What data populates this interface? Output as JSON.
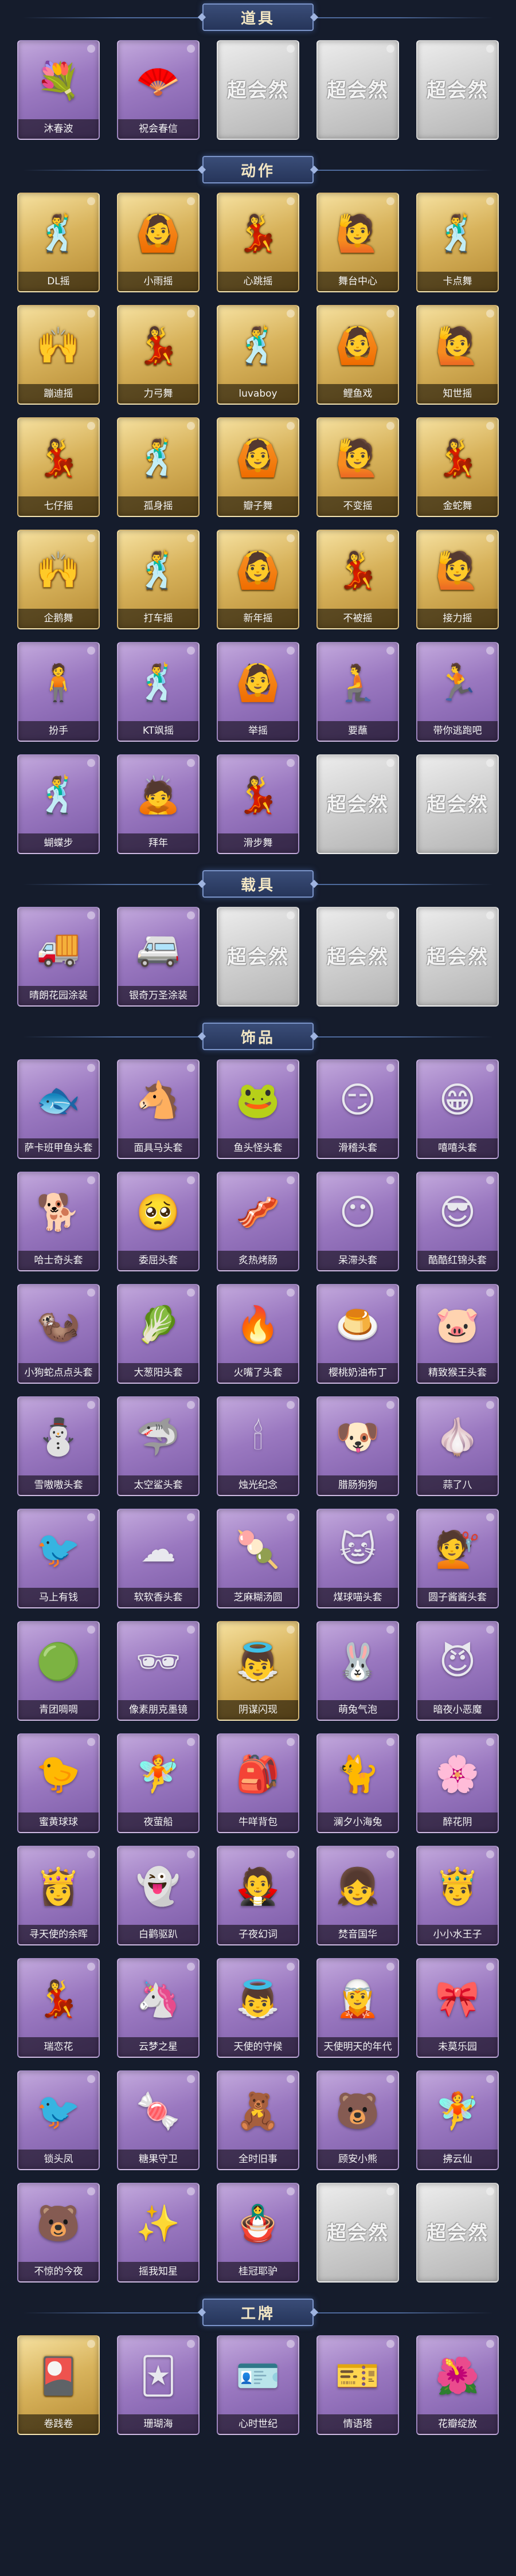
{
  "sections": [
    {
      "title": "道具",
      "rows": 1,
      "items": [
        {
          "label": "沐春波",
          "rarity": "purple",
          "icon": "flower-wreath-icon",
          "glyph": "💐"
        },
        {
          "label": "祝会春信",
          "rarity": "purple",
          "icon": "fan-icon",
          "glyph": "🪭"
        },
        {
          "label": "",
          "rarity": "gray",
          "icon": "placeholder-logo-icon",
          "placeholder": "超会然"
        },
        {
          "label": "",
          "rarity": "gray",
          "icon": "placeholder-logo-icon",
          "placeholder": "超会然"
        },
        {
          "label": "",
          "rarity": "gray",
          "icon": "placeholder-logo-icon",
          "placeholder": "超会然"
        }
      ]
    },
    {
      "title": "动作",
      "rows": 6,
      "items": [
        {
          "label": "DL摇",
          "rarity": "gold",
          "icon": "dance-pose-icon",
          "glyph": "🕺"
        },
        {
          "label": "小雨摇",
          "rarity": "gold",
          "icon": "dance-pose-icon",
          "glyph": "🙆"
        },
        {
          "label": "心跳摇",
          "rarity": "gold",
          "icon": "dance-pose-icon",
          "glyph": "💃"
        },
        {
          "label": "舞台中心",
          "rarity": "gold",
          "icon": "dance-pose-icon",
          "glyph": "🙋"
        },
        {
          "label": "卡点舞",
          "rarity": "gold",
          "icon": "dance-pose-icon",
          "glyph": "🕺"
        },
        {
          "label": "蹦迪摇",
          "rarity": "gold",
          "icon": "dance-pose-icon",
          "glyph": "🙌"
        },
        {
          "label": "力弓舞",
          "rarity": "gold",
          "icon": "dance-pose-icon",
          "glyph": "💃"
        },
        {
          "label": "luvaboy",
          "rarity": "gold",
          "icon": "dance-pose-icon",
          "glyph": "🕺"
        },
        {
          "label": "鲤鱼戏",
          "rarity": "gold",
          "icon": "dance-pose-icon",
          "glyph": "🙆"
        },
        {
          "label": "知世摇",
          "rarity": "gold",
          "icon": "dance-pose-icon",
          "glyph": "🙋"
        },
        {
          "label": "七仔摇",
          "rarity": "gold",
          "icon": "dance-pose-icon",
          "glyph": "💃"
        },
        {
          "label": "孤身摇",
          "rarity": "gold",
          "icon": "dance-pose-icon",
          "glyph": "🕺"
        },
        {
          "label": "瓣子舞",
          "rarity": "gold",
          "icon": "dance-pose-icon",
          "glyph": "🙆"
        },
        {
          "label": "不变摇",
          "rarity": "gold",
          "icon": "dance-pose-icon",
          "glyph": "🙋"
        },
        {
          "label": "金蛇舞",
          "rarity": "gold",
          "icon": "dance-pose-icon",
          "glyph": "💃"
        },
        {
          "label": "企鹅舞",
          "rarity": "gold",
          "icon": "dance-pose-icon",
          "glyph": "🙌"
        },
        {
          "label": "打车摇",
          "rarity": "gold",
          "icon": "dance-pose-icon",
          "glyph": "🕺"
        },
        {
          "label": "新年摇",
          "rarity": "gold",
          "icon": "dance-pose-icon",
          "glyph": "🙆"
        },
        {
          "label": "不被摇",
          "rarity": "gold",
          "icon": "dance-pose-icon",
          "glyph": "💃"
        },
        {
          "label": "接力摇",
          "rarity": "gold",
          "icon": "dance-pose-icon",
          "glyph": "🙋"
        },
        {
          "label": "扮手",
          "rarity": "purple",
          "icon": "dance-pose-icon",
          "glyph": "🧍"
        },
        {
          "label": "KT飒摇",
          "rarity": "purple",
          "icon": "dance-pose-icon",
          "glyph": "🕺"
        },
        {
          "label": "举摇",
          "rarity": "purple",
          "icon": "dance-pose-icon",
          "glyph": "🙆"
        },
        {
          "label": "要蘸",
          "rarity": "purple",
          "icon": "dance-pose-icon",
          "glyph": "🧎"
        },
        {
          "label": "带你逃跑吧",
          "rarity": "purple",
          "icon": "dance-pose-icon",
          "glyph": "🏃"
        },
        {
          "label": "蝴蝶步",
          "rarity": "purple",
          "icon": "dance-pose-icon",
          "glyph": "🕺"
        },
        {
          "label": "拜年",
          "rarity": "purple",
          "icon": "dance-pose-icon",
          "glyph": "🙇"
        },
        {
          "label": "滑步舞",
          "rarity": "purple",
          "icon": "dance-pose-icon",
          "glyph": "💃"
        },
        {
          "label": "",
          "rarity": "gray",
          "icon": "placeholder-logo-icon",
          "placeholder": "超会然"
        },
        {
          "label": "",
          "rarity": "gray",
          "icon": "placeholder-logo-icon",
          "placeholder": "超会然"
        }
      ]
    },
    {
      "title": "载具",
      "rows": 1,
      "items": [
        {
          "label": "晴朗花园涂装",
          "rarity": "purple",
          "icon": "ice-cream-truck-icon",
          "glyph": "🚚"
        },
        {
          "label": "银奇万圣涂装",
          "rarity": "purple",
          "icon": "food-truck-icon",
          "glyph": "🚐"
        },
        {
          "label": "",
          "rarity": "gray",
          "icon": "placeholder-logo-icon",
          "placeholder": "超会然"
        },
        {
          "label": "",
          "rarity": "gray",
          "icon": "placeholder-logo-icon",
          "placeholder": "超会然"
        },
        {
          "label": "",
          "rarity": "gray",
          "icon": "placeholder-logo-icon",
          "placeholder": "超会然"
        }
      ]
    },
    {
      "title": "饰品",
      "rows": 11,
      "items": [
        {
          "label": "萨卡班甲鱼头套",
          "rarity": "purple",
          "icon": "fish-head-icon",
          "glyph": "🐟"
        },
        {
          "label": "面具马头套",
          "rarity": "purple",
          "icon": "horse-head-icon",
          "glyph": "🐴"
        },
        {
          "label": "鱼头怪头套",
          "rarity": "purple",
          "icon": "fish-monster-icon",
          "glyph": "🐸"
        },
        {
          "label": "滑稽头套",
          "rarity": "purple",
          "icon": "smiley-icon",
          "glyph": "😏"
        },
        {
          "label": "嘻嘻头套",
          "rarity": "purple",
          "icon": "grin-icon",
          "glyph": "😁"
        },
        {
          "label": "哈士奇头套",
          "rarity": "purple",
          "icon": "husky-icon",
          "glyph": "🐕"
        },
        {
          "label": "委屈头套",
          "rarity": "purple",
          "icon": "sad-face-icon",
          "glyph": "🥺"
        },
        {
          "label": "炙热烤肠",
          "rarity": "purple",
          "icon": "sausage-icon",
          "glyph": "🥓"
        },
        {
          "label": "呆滞头套",
          "rarity": "purple",
          "icon": "blank-face-icon",
          "glyph": "😶"
        },
        {
          "label": "酷酷红锦头套",
          "rarity": "purple",
          "icon": "cool-pikachu-icon",
          "glyph": "😎"
        },
        {
          "label": "小狗蛇点点头套",
          "rarity": "purple",
          "icon": "blob-icon",
          "glyph": "🦦"
        },
        {
          "label": "大葱阳头套",
          "rarity": "purple",
          "icon": "scallion-icon",
          "glyph": "🥬"
        },
        {
          "label": "火嘴了头套",
          "rarity": "purple",
          "icon": "fire-icon",
          "glyph": "🔥"
        },
        {
          "label": "樱桃奶油布丁",
          "rarity": "purple",
          "icon": "pudding-icon",
          "glyph": "🍮"
        },
        {
          "label": "精致猴王头套",
          "rarity": "purple",
          "icon": "pink-pig-icon",
          "glyph": "🐷"
        },
        {
          "label": "雪嗷嗷头套",
          "rarity": "purple",
          "icon": "snowman-icon",
          "glyph": "⛄"
        },
        {
          "label": "太空鲨头套",
          "rarity": "purple",
          "icon": "shark-icon",
          "glyph": "🦈"
        },
        {
          "label": "烛光纪念",
          "rarity": "purple",
          "icon": "candle-icon",
          "glyph": "🕯"
        },
        {
          "label": "腊肠狗狗",
          "rarity": "purple",
          "icon": "dog-icon",
          "glyph": "🐶"
        },
        {
          "label": "蒜了八",
          "rarity": "purple",
          "icon": "garlic-icon",
          "glyph": "🧄"
        },
        {
          "label": "马上有钱",
          "rarity": "purple",
          "icon": "money-bird-icon",
          "glyph": "🐦"
        },
        {
          "label": "软软香头套",
          "rarity": "purple",
          "icon": "cloud-icon",
          "glyph": "☁"
        },
        {
          "label": "芝麻糊汤圆",
          "rarity": "purple",
          "icon": "dumpling-icon",
          "glyph": "🍡"
        },
        {
          "label": "煤球喵头套",
          "rarity": "purple",
          "icon": "black-cat-icon",
          "glyph": "🐱"
        },
        {
          "label": "圆子酱酱头套",
          "rarity": "purple",
          "icon": "hair-bun-icon",
          "glyph": "💇"
        },
        {
          "label": "青团啁啁",
          "rarity": "purple",
          "icon": "green-blob-icon",
          "glyph": "🟢"
        },
        {
          "label": "像素朋克墨镜",
          "rarity": "purple",
          "icon": "pixel-sunglasses-icon",
          "glyph": "🕶"
        },
        {
          "label": "阴谋闪现",
          "rarity": "gold",
          "icon": "angel-icon",
          "glyph": "👼"
        },
        {
          "label": "萌兔气泡",
          "rarity": "purple",
          "icon": "bunny-icon",
          "glyph": "🐰"
        },
        {
          "label": "暗夜小恶魔",
          "rarity": "purple",
          "icon": "devil-icon",
          "glyph": "😈"
        },
        {
          "label": "蜜黄球球",
          "rarity": "purple",
          "icon": "chick-icon",
          "glyph": "🐤"
        },
        {
          "label": "夜萤船",
          "rarity": "purple",
          "icon": "fairy-icon",
          "glyph": "🧚"
        },
        {
          "label": "牛咩背包",
          "rarity": "purple",
          "icon": "backpack-icon",
          "glyph": "🎒"
        },
        {
          "label": "澜夕小海兔",
          "rarity": "purple",
          "icon": "blue-cat-icon",
          "glyph": "🐈"
        },
        {
          "label": "醉花阴",
          "rarity": "purple",
          "icon": "flower-girl-icon",
          "glyph": "🌸"
        },
        {
          "label": "寻天使的余晖",
          "rarity": "purple",
          "icon": "angel-girl-icon",
          "glyph": "👸"
        },
        {
          "label": "白鹳驱趴",
          "rarity": "purple",
          "icon": "ghost-icon",
          "glyph": "👻"
        },
        {
          "label": "子夜幻词",
          "rarity": "purple",
          "icon": "dark-girl-icon",
          "glyph": "🧛"
        },
        {
          "label": "焚音国华",
          "rarity": "purple",
          "icon": "girl-icon",
          "glyph": "👧"
        },
        {
          "label": "小小水王子",
          "rarity": "purple",
          "icon": "prince-icon",
          "glyph": "🤴"
        },
        {
          "label": "瑞恋花",
          "rarity": "purple",
          "icon": "gold-girl-icon",
          "glyph": "💃"
        },
        {
          "label": "云梦之星",
          "rarity": "purple",
          "icon": "unicorn-icon",
          "glyph": "🦄"
        },
        {
          "label": "天使的守候",
          "rarity": "purple",
          "icon": "cherub-icon",
          "glyph": "👼"
        },
        {
          "label": "天使明天的年代",
          "rarity": "purple",
          "icon": "angel-doll-icon",
          "glyph": "🧝"
        },
        {
          "label": "未莫乐园",
          "rarity": "purple",
          "icon": "pink-girl-icon",
          "glyph": "🎀"
        },
        {
          "label": "锁头凤",
          "rarity": "purple",
          "icon": "phoenix-icon",
          "glyph": "🐦"
        },
        {
          "label": "糖果守卫",
          "rarity": "purple",
          "icon": "candy-guard-icon",
          "glyph": "🍬"
        },
        {
          "label": "全时旧事",
          "rarity": "purple",
          "icon": "keychain-doll-icon",
          "glyph": "🧸"
        },
        {
          "label": "顾安小熊",
          "rarity": "purple",
          "icon": "bear-keychain-icon",
          "glyph": "🐻"
        },
        {
          "label": "拂云仙",
          "rarity": "purple",
          "icon": "fairy-keychain-icon",
          "glyph": "🧚"
        },
        {
          "label": "不惊的今夜",
          "rarity": "purple",
          "icon": "pink-bear-icon",
          "glyph": "🐻"
        },
        {
          "label": "摇我知星",
          "rarity": "purple",
          "icon": "charm-icon",
          "glyph": "✨"
        },
        {
          "label": "桂冠耶驴",
          "rarity": "purple",
          "icon": "charm-doll-icon",
          "glyph": "🪆"
        },
        {
          "label": "",
          "rarity": "gray",
          "icon": "placeholder-logo-icon",
          "placeholder": "超会然"
        },
        {
          "label": "",
          "rarity": "gray",
          "icon": "placeholder-logo-icon",
          "placeholder": "超会然"
        }
      ]
    },
    {
      "title": "工牌",
      "rows": 1,
      "items": [
        {
          "label": "卷践卷",
          "rarity": "gold",
          "icon": "badge-card-icon",
          "glyph": "🎴"
        },
        {
          "label": "珊瑚海",
          "rarity": "purple",
          "icon": "badge-card-icon",
          "glyph": "🃏"
        },
        {
          "label": "心时世纪",
          "rarity": "purple",
          "icon": "badge-card-icon",
          "glyph": "🪪"
        },
        {
          "label": "情语塔",
          "rarity": "purple",
          "icon": "badge-card-icon",
          "glyph": "🎫"
        },
        {
          "label": "花瓣绽放",
          "rarity": "purple",
          "icon": "badge-card-icon",
          "glyph": "🌺"
        }
      ]
    }
  ]
}
